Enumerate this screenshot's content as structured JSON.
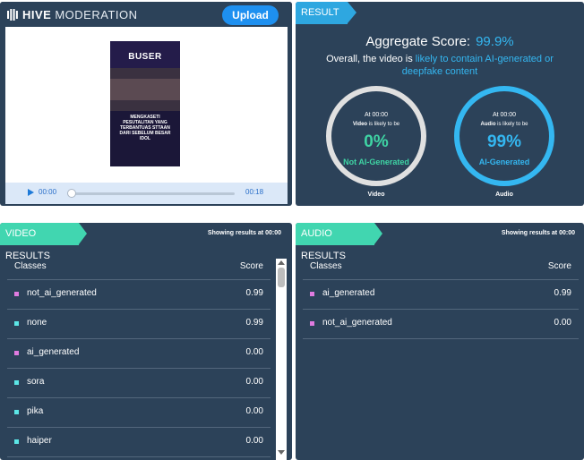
{
  "app": {
    "brand_bold": "HIVE",
    "brand_light": "MODERATION",
    "upload_label": "Upload"
  },
  "media": {
    "thumb_title": "BUSER",
    "thumb_caption": "MENGKASETI PESUTALITAN YANG TERBANTUAS STTAAN DARI SEBELUM BESAR IDOL",
    "time_current": "00:00",
    "time_total": "00:18",
    "progress": 0
  },
  "result": {
    "tab_label": "RESULT",
    "aggregate_label": "Aggregate Score:",
    "aggregate_value": "99.9%",
    "overall_prefix": "Overall, the video is",
    "overall_highlight": "likely to contain AI-generated or deepfake content",
    "video_gauge": {
      "at": "At 00:00",
      "kind": "Video",
      "likely": "is likely to be",
      "percent": "0%",
      "label": "Not AI-Generated",
      "caption": "Video",
      "ring_color": "#e0e0e0",
      "text_color": "#3fd4a4",
      "fraction": 0
    },
    "audio_gauge": {
      "at": "At 00:00",
      "kind": "Audio",
      "likely": "is likely to be",
      "percent": "99%",
      "label": "AI-Generated",
      "caption": "Audio",
      "ring_color": "#34b7f1",
      "text_color": "#34b7f1",
      "fraction": 0.99
    }
  },
  "video_results": {
    "tab_label": "VIDEO RESULTS",
    "showing": "Showing results at 00:00",
    "col_classes": "Classes",
    "col_score": "Score",
    "rows": [
      {
        "name": "not_ai_generated",
        "score": "0.99",
        "color": "#e07be0"
      },
      {
        "name": "none",
        "score": "0.99",
        "color": "#5ce6e6"
      },
      {
        "name": "ai_generated",
        "score": "0.00",
        "color": "#e07be0"
      },
      {
        "name": "sora",
        "score": "0.00",
        "color": "#5ce6e6"
      },
      {
        "name": "pika",
        "score": "0.00",
        "color": "#5ce6e6"
      },
      {
        "name": "haiper",
        "score": "0.00",
        "color": "#5ce6e6"
      }
    ]
  },
  "audio_results": {
    "tab_label": "AUDIO RESULTS",
    "showing": "Showing results at 00:00",
    "col_classes": "Classes",
    "col_score": "Score",
    "rows": [
      {
        "name": "ai_generated",
        "score": "0.99",
        "color": "#e07be0"
      },
      {
        "name": "not_ai_generated",
        "score": "0.00",
        "color": "#e07be0"
      }
    ]
  }
}
